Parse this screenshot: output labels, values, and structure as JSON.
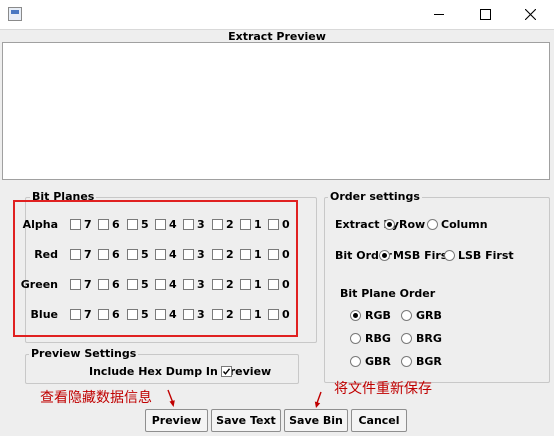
{
  "window": {
    "title_icon": "app-icon",
    "controls": [
      "minimize-icon",
      "maximize-icon",
      "close-icon"
    ]
  },
  "preview": {
    "title": "Extract Preview"
  },
  "bit_planes": {
    "title": "Bit Planes",
    "bit_labels": [
      "7",
      "6",
      "5",
      "4",
      "3",
      "2",
      "1",
      "0"
    ],
    "rows": [
      "Alpha",
      "Red",
      "Green",
      "Blue"
    ]
  },
  "order": {
    "title": "Order settings",
    "extract_by": {
      "label": "Extract By",
      "options": [
        "Row",
        "Column"
      ],
      "selected": "Row"
    },
    "bit_order": {
      "label": "Bit Order",
      "options": [
        "MSB First",
        "LSB First"
      ],
      "selected": "MSB First"
    },
    "plane_order": {
      "label": "Bit Plane Order",
      "options": [
        "RGB",
        "GRB",
        "RBG",
        "BRG",
        "GBR",
        "BGR"
      ],
      "selected": "RGB"
    }
  },
  "preview_settings": {
    "title": "Preview Settings",
    "hexdump_label": "Include Hex Dump In Preview",
    "hexdump_checked": true
  },
  "buttons": {
    "preview": "Preview",
    "save_text": "Save Text",
    "save_bin": "Save Bin",
    "cancel": "Cancel"
  },
  "annotations": {
    "left": "查看隐藏数据信息",
    "right": "将文件重新保存",
    "color": "#c00000",
    "box_color": "#e02020"
  }
}
